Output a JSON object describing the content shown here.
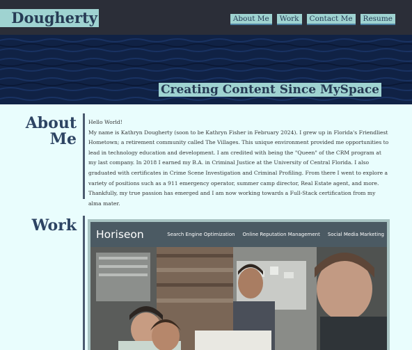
{
  "header": {
    "brand": "Dougherty",
    "nav": [
      {
        "label": "About Me"
      },
      {
        "label": "Work"
      },
      {
        "label": "Contact Me"
      },
      {
        "label": "Resume"
      }
    ]
  },
  "hero": {
    "tagline": "Creating Content Since MySpace"
  },
  "about": {
    "title_line1": "About",
    "title_line2": "Me",
    "greeting": "Hello World!",
    "body": "My name is Kathryn Dougherty (soon to be Kathryn Fisher in February 2024). I grew up in Florida's Friendliest Hometown; a retirement community called The Villages. This unique environment provided me opportunities to lead in technology education and development. I am credited with being the \"Queen\" of the CRM program at my last company. In 2018 I earned my B.A. in Criminal Justice at the University of Central Florida. I also graduated with certificates in Crime Scene Investigation and Criminal Profiling. From there I went to explore a variety of positions such as a 911 emergency operator, summer camp director, Real Estate agent, and more. Thankfully, my true passion has emerged and I am now working towards a Full-Stack certification from my alma mater."
  },
  "work": {
    "title": "Work",
    "project": {
      "logo": "Horiseon",
      "nav": [
        "Search Engine Optimization",
        "Online Reputation Management",
        "Social Media Marketing"
      ]
    }
  },
  "colors": {
    "header_bg": "#2b2e38",
    "accent": "#9fd3d1",
    "heading": "#2d4463",
    "hero_bg": "#102245",
    "page_bg": "#e9fdfd"
  }
}
